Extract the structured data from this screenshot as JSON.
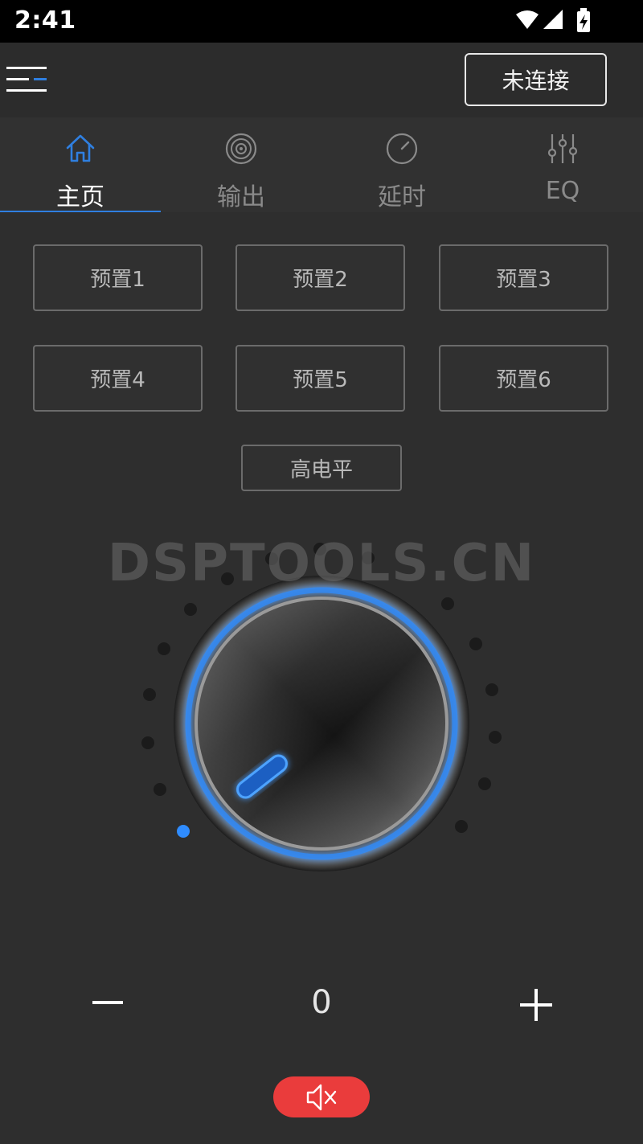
{
  "status_bar": {
    "time": "2:41",
    "icons": [
      "wifi-icon",
      "signal-icon",
      "battery-charging-icon"
    ]
  },
  "app_bar": {
    "menu_icon": "menu-icon",
    "connect_label": "未连接"
  },
  "tabs": [
    {
      "label": "主页",
      "icon": "home-icon",
      "active": true
    },
    {
      "label": "输出",
      "icon": "speaker-icon",
      "active": false
    },
    {
      "label": "延时",
      "icon": "gauge-icon",
      "active": false
    },
    {
      "label": "EQ",
      "icon": "equalizer-icon",
      "active": false
    }
  ],
  "presets": [
    "预置1",
    "预置2",
    "预置3",
    "预置4",
    "预置5",
    "预置6"
  ],
  "high_level_label": "高电平",
  "watermark": "DSPTOOLS.CN",
  "volume": {
    "value": "0",
    "minus_icon": "minus-icon",
    "plus_icon": "plus-icon",
    "knob_level": 0
  },
  "mute_icon": "mute-icon",
  "colors": {
    "accent": "#2f7fe0",
    "background": "#2e2e2e",
    "mute": "#ea3c3c"
  }
}
